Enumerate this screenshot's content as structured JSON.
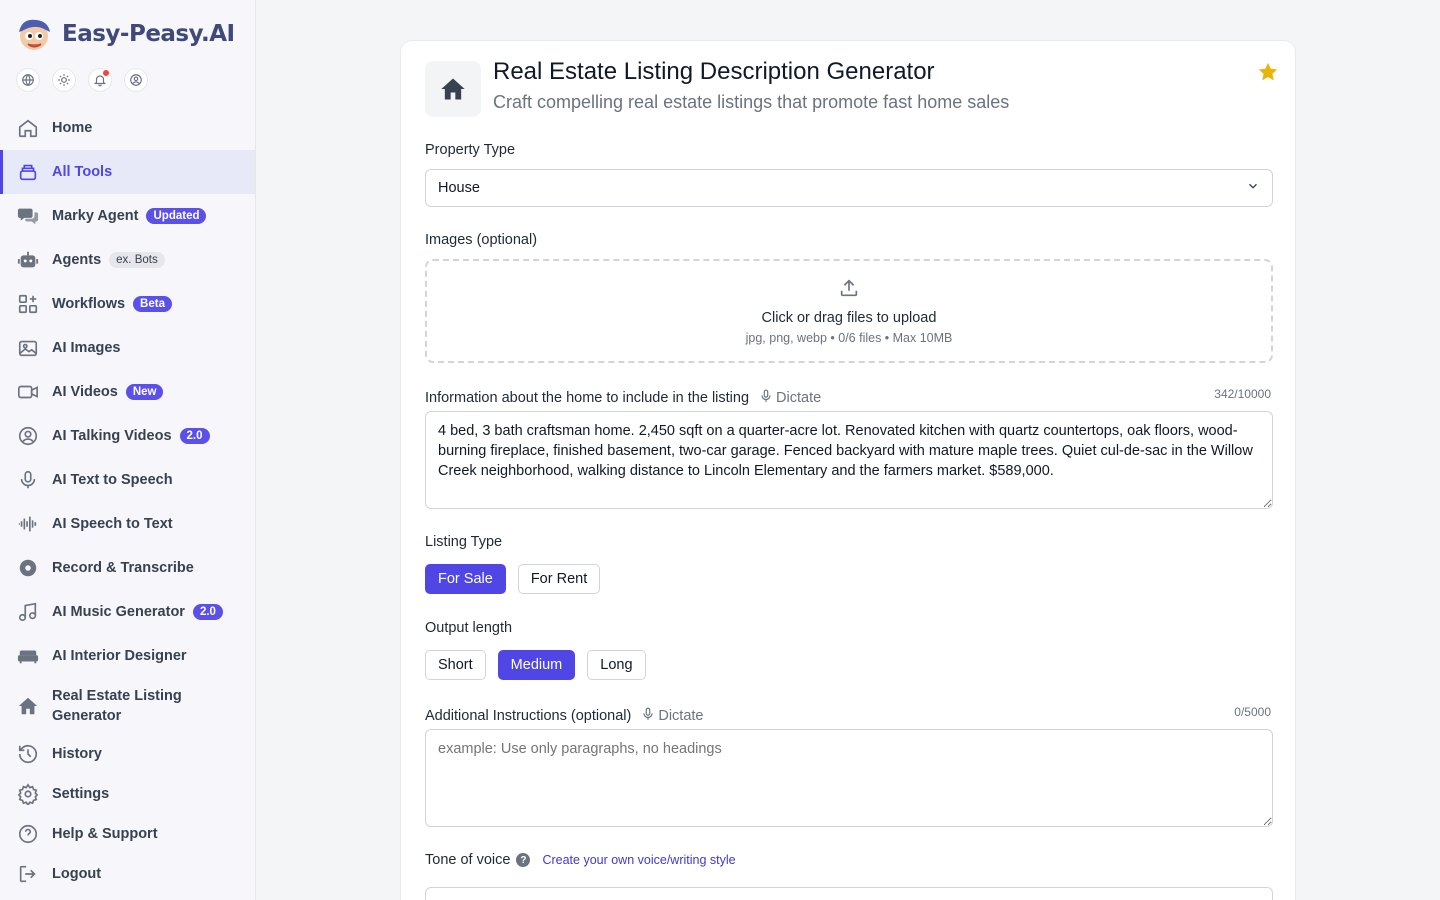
{
  "brand": {
    "name": "Easy-Peasy.AI"
  },
  "top_icons": [
    "globe-icon",
    "sun-icon",
    "bell-icon",
    "user-circle-icon"
  ],
  "sidebar": {
    "items": [
      {
        "label": "Home",
        "icon": "home-icon"
      },
      {
        "label": "All Tools",
        "icon": "layers-icon",
        "active": true
      },
      {
        "label": "Marky Agent",
        "icon": "chat-icon",
        "badge": "Updated"
      },
      {
        "label": "Agents",
        "icon": "robot-icon",
        "badge": "ex. Bots"
      },
      {
        "label": "Workflows",
        "icon": "workflow-icon",
        "badge": "Beta"
      },
      {
        "label": "AI Images",
        "icon": "images-icon"
      },
      {
        "label": "AI Videos",
        "icon": "video-icon",
        "badge": "New"
      },
      {
        "label": "AI Talking Videos",
        "icon": "talking-avatar-icon",
        "badge": "2.0"
      },
      {
        "label": "AI Text to Speech",
        "icon": "microphone-icon"
      },
      {
        "label": "AI Speech to Text",
        "icon": "waveform-icon"
      },
      {
        "label": "Record & Transcribe",
        "icon": "record-icon"
      },
      {
        "label": "AI Music Generator",
        "icon": "music-icon",
        "badge": "2.0"
      },
      {
        "label": "AI Interior Designer",
        "icon": "sofa-icon"
      },
      {
        "label": "Real Estate Listing Generator",
        "icon": "house-icon"
      },
      {
        "label": "History",
        "icon": "history-icon"
      },
      {
        "label": "Settings",
        "icon": "gear-icon"
      },
      {
        "label": "Help & Support",
        "icon": "help-icon"
      },
      {
        "label": "Logout",
        "icon": "logout-icon"
      }
    ]
  },
  "tool": {
    "title": "Real Estate Listing Description Generator",
    "subtitle": "Craft compelling real estate listings that promote fast home sales"
  },
  "form": {
    "property_type": {
      "label": "Property Type",
      "value": "House"
    },
    "images": {
      "label": "Images (optional)",
      "main": "Click or drag files to upload",
      "sub": "jpg, png, webp • 0/6 files • Max 10MB"
    },
    "info": {
      "label": "Information about the home to include in the listing",
      "dictate": "Dictate",
      "counter": "342/10000",
      "value": "4 bed, 3 bath craftsman home. 2,450 sqft on a quarter-acre lot. Renovated kitchen with quartz countertops, oak floors, wood-burning fireplace, finished basement, two-car garage. Fenced backyard with mature maple trees. Quiet cul-de-sac in the Willow Creek neighborhood, walking distance to Lincoln Elementary and the farmers market. $589,000."
    },
    "listing_type": {
      "label": "Listing Type",
      "options": [
        "For Sale",
        "For Rent"
      ],
      "selected": "For Sale"
    },
    "output_length": {
      "label": "Output length",
      "options": [
        "Short",
        "Medium",
        "Long"
      ],
      "selected": "Medium"
    },
    "additional": {
      "label": "Additional Instructions (optional)",
      "dictate": "Dictate",
      "counter": "0/5000",
      "placeholder": "example: Use only paragraphs, no headings"
    },
    "tone": {
      "label": "Tone of voice",
      "help": "?",
      "link": "Create your own voice/writing style"
    }
  },
  "colors": {
    "accent": "#4f46e5",
    "star": "#eab308",
    "notification": "#ef4444"
  }
}
